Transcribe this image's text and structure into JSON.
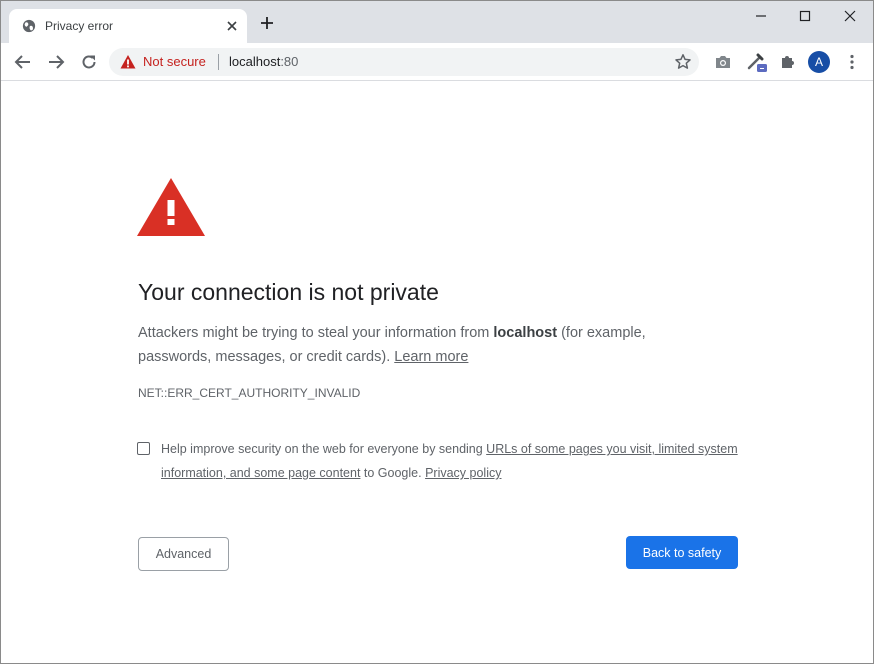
{
  "browser": {
    "tab": {
      "title": "Privacy error",
      "favicon": "globe-icon"
    },
    "omnibox": {
      "security_label": "Not secure",
      "url_host": "localhost",
      "url_port": ":80"
    },
    "profile_initial": "A"
  },
  "page": {
    "heading": "Your connection is not private",
    "explanation": {
      "before": "Attackers might be trying to steal your information from ",
      "host": "localhost",
      "after": " (for example, passwords, messages, or credit cards). ",
      "learn_more": "Learn more"
    },
    "error_code": "NET::ERR_CERT_AUTHORITY_INVALID",
    "optin": {
      "checked": false,
      "before": "Help improve security on the web for everyone by sending ",
      "link": "URLs of some pages you visit, limited system information, and some page content",
      "middle": " to Google. ",
      "privacy_link": "Privacy policy"
    },
    "advanced_button": "Advanced",
    "safety_button": "Back to safety"
  },
  "colors": {
    "warning_red": "#d93025",
    "primary_blue": "#1a73e8",
    "not_secure_red": "#c5221f"
  }
}
